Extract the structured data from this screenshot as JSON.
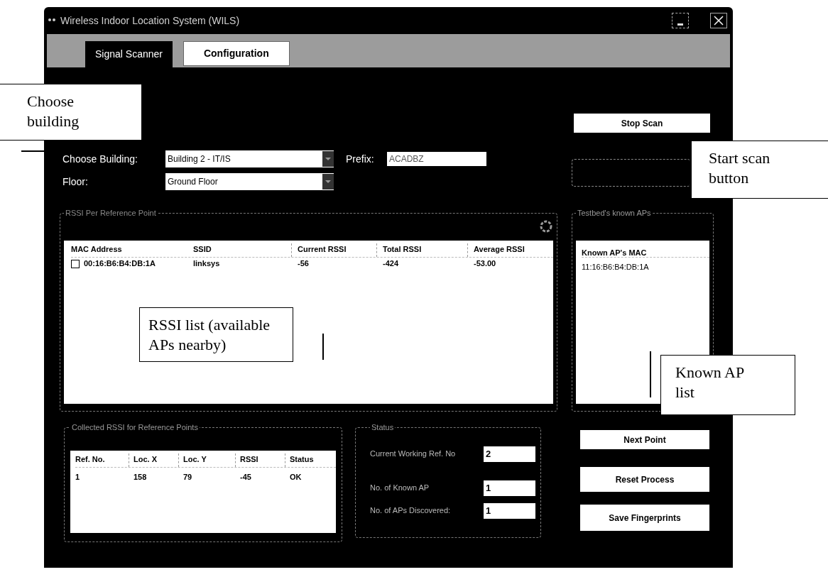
{
  "window": {
    "title": "Wireless Indoor Location System (WILS)"
  },
  "tabs": [
    {
      "label": "Signal Scanner",
      "selected": true
    },
    {
      "label": "Configuration",
      "selected": false
    }
  ],
  "stop_scan_button": "Stop Scan",
  "building": {
    "label": "Choose Building:",
    "value": "Building 2 - IT/IS"
  },
  "prefix": {
    "label": "Prefix:",
    "value": "ACADBZ"
  },
  "floor": {
    "label": "Floor:",
    "value": "Ground Floor"
  },
  "rssi_group": {
    "title": "RSSI Per Reference Point",
    "columns": [
      "MAC Address",
      "SSID",
      "Current RSSI",
      "Total RSSI",
      "Average RSSI"
    ],
    "rows": [
      {
        "checked": false,
        "cells": [
          "00:16:B6:B4:DB:1A",
          "linksys",
          "-56",
          "-424",
          "-53.00"
        ]
      }
    ]
  },
  "known_aps": {
    "title": "Testbed's known APs",
    "column": "Known AP's MAC",
    "rows": [
      "11:16:B6:B4:DB:1A"
    ]
  },
  "collected": {
    "title": "Collected RSSI for Reference Points",
    "columns": [
      "Ref. No.",
      "Loc. X",
      "Loc. Y",
      "RSSI",
      "Status"
    ],
    "rows": [
      [
        "1",
        "158",
        "79",
        "-45",
        "OK"
      ]
    ]
  },
  "status": {
    "title": "Status",
    "fields": [
      {
        "label": "Current Working Ref. No",
        "value": "2"
      },
      {
        "label": "No. of Known AP",
        "value": "1"
      },
      {
        "label": "No. of APs Discovered:",
        "value": "1"
      }
    ]
  },
  "buttons": [
    "Next Point",
    "Reset Process",
    "Save Fingerprints"
  ],
  "annotations": [
    {
      "text": "Choose building"
    },
    {
      "text": "Start scan button"
    },
    {
      "text": "RSSI list (available APs nearby)"
    },
    {
      "text": "Known AP list"
    }
  ]
}
